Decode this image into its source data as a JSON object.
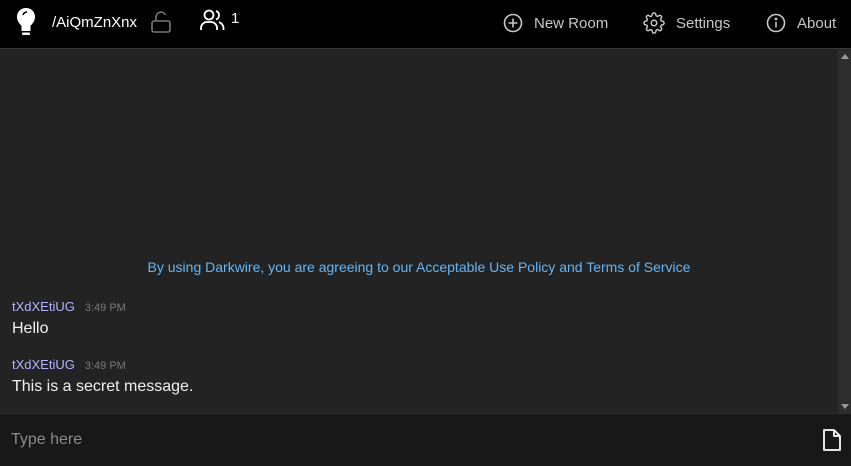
{
  "header": {
    "room_name": "/AiQmZnXnx",
    "users_count": "1",
    "new_room_label": "New Room",
    "settings_label": "Settings",
    "about_label": "About"
  },
  "chat": {
    "notice": "By using Darkwire, you are agreeing to our Acceptable Use Policy and Terms of Service",
    "messages": [
      {
        "user": "tXdXEtiUG",
        "time": "3:49 PM",
        "text": "Hello"
      },
      {
        "user": "tXdXEtiUG",
        "time": "3:49 PM",
        "text": "This is a secret message."
      }
    ]
  },
  "composer": {
    "placeholder": "Type here"
  },
  "icons": {
    "logo": "lightbulb-icon",
    "lock": "unlock-icon",
    "users": "users-icon",
    "new_room": "plus-circle-icon",
    "settings": "gear-icon",
    "about": "info-circle-icon",
    "file": "file-icon"
  },
  "colors": {
    "navbar_bg": "#000000",
    "chat_bg": "#232323",
    "notice_link": "#64b5f6",
    "username": "#b3b3ff"
  }
}
